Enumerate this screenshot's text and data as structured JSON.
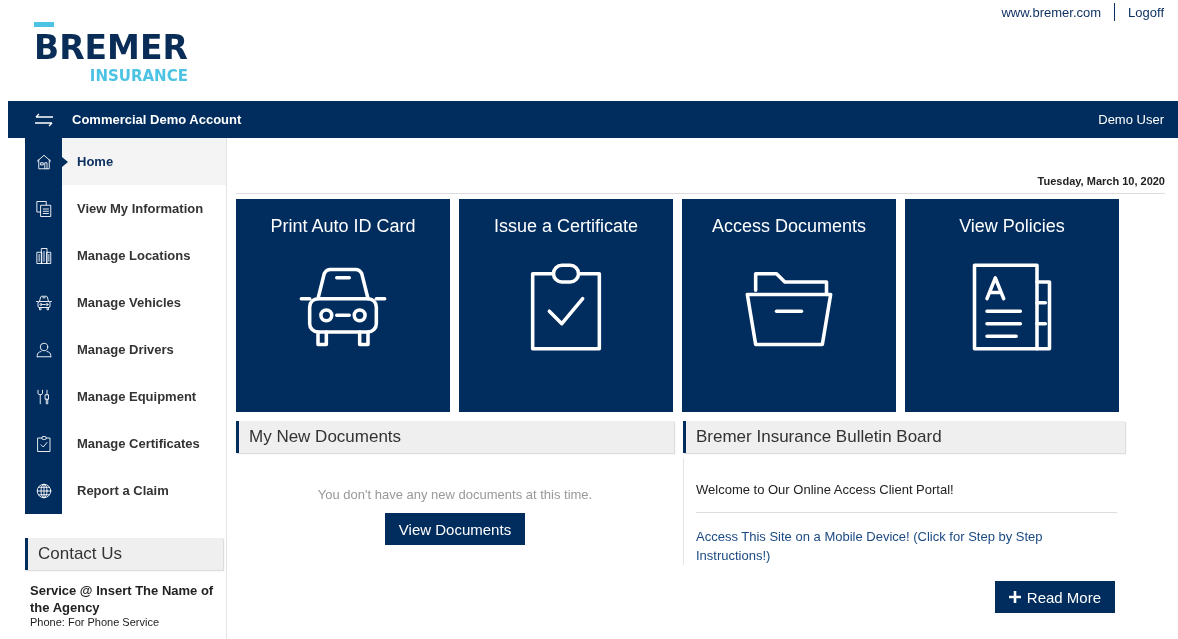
{
  "header": {
    "logo": {
      "top": "BREMER",
      "bottom": "INSURANCE"
    },
    "links": [
      "www.bremer.com",
      "Logoff"
    ]
  },
  "nav_bar": {
    "account": "Commercial Demo Account",
    "user": "Demo User"
  },
  "sidebar": {
    "items": [
      {
        "label": "Home",
        "selected": true
      },
      {
        "label": "View My Information",
        "selected": false
      },
      {
        "label": "Manage Locations",
        "selected": false
      },
      {
        "label": "Manage Vehicles",
        "selected": false
      },
      {
        "label": "Manage Drivers",
        "selected": false
      },
      {
        "label": "Manage Equipment",
        "selected": false
      },
      {
        "label": "Manage Certificates",
        "selected": false
      },
      {
        "label": "Report a Claim",
        "selected": false
      }
    ]
  },
  "date": "Tuesday, March 10, 2020",
  "tiles": [
    {
      "title": "Print Auto ID Card"
    },
    {
      "title": "Issue a Certificate"
    },
    {
      "title": "Access Documents"
    },
    {
      "title": "View Policies"
    }
  ],
  "new_documents": {
    "title": "My New Documents",
    "message": "You don't have any new documents at this time.",
    "button": "View Documents"
  },
  "bulletin": {
    "title": "Bremer Insurance Bulletin Board",
    "items": [
      {
        "kind": "text",
        "text": "Welcome to Our Online Access Client Portal!"
      },
      {
        "kind": "link",
        "text": "Access This Site on a Mobile Device! (Click for Step by Step Instructions!)"
      }
    ],
    "button": "Read More"
  },
  "contact": {
    "title": "Contact Us",
    "name": "Service @ Insert The Name of the Agency",
    "phone": "Phone: For Phone Service"
  }
}
